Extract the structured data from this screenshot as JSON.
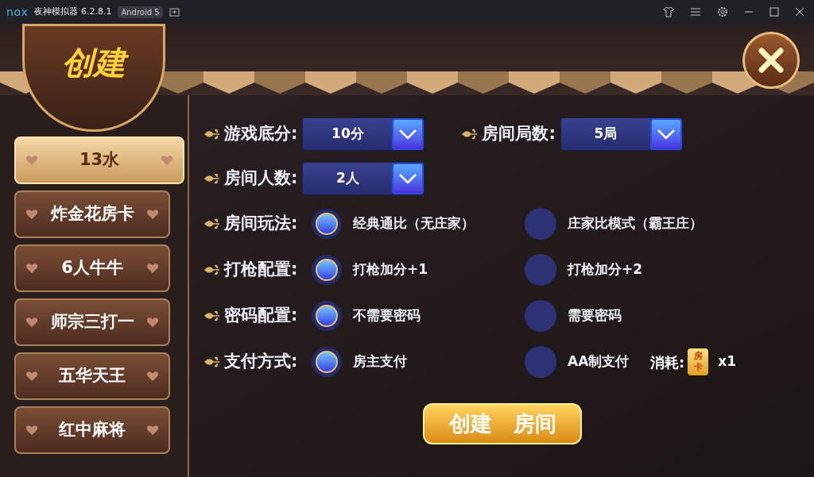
{
  "window": {
    "logo": "nox",
    "title": "夜神模拟器 6.2.8.1",
    "badge": "Android 5"
  },
  "header": {
    "title": "创建"
  },
  "games": [
    {
      "label": "13水",
      "selected": true
    },
    {
      "label": "炸金花房卡",
      "selected": false
    },
    {
      "label": "6人牛牛",
      "selected": false
    },
    {
      "label": "师宗三打一",
      "selected": false
    },
    {
      "label": "五华天王",
      "selected": false
    },
    {
      "label": "红中麻将",
      "selected": false
    }
  ],
  "dropdown_rows": [
    [
      {
        "label": "游戏底分:",
        "value": "10分"
      },
      {
        "label": "房间局数:",
        "value": "5局"
      }
    ],
    [
      {
        "label": "房间人数:",
        "value": "2人"
      }
    ]
  ],
  "option_rows": [
    {
      "label": "房间玩法:",
      "options": [
        {
          "label": "经典通比（无庄家）",
          "selected": true
        },
        {
          "label": "庄家比模式（霸王庄）",
          "selected": false
        }
      ]
    },
    {
      "label": "打枪配置:",
      "options": [
        {
          "label": "打枪加分+1",
          "selected": true
        },
        {
          "label": "打枪加分+2",
          "selected": false
        }
      ]
    },
    {
      "label": "密码配置:",
      "options": [
        {
          "label": "不需要密码",
          "selected": true
        },
        {
          "label": "需要密码",
          "selected": false
        }
      ]
    },
    {
      "label": "支付方式:",
      "options": [
        {
          "label": "房主支付",
          "selected": true
        },
        {
          "label": "AA制支付",
          "selected": false
        }
      ]
    }
  ],
  "cost": {
    "label": "消耗:",
    "card": "房卡",
    "count": "x1"
  },
  "create_button": "创建　房间"
}
